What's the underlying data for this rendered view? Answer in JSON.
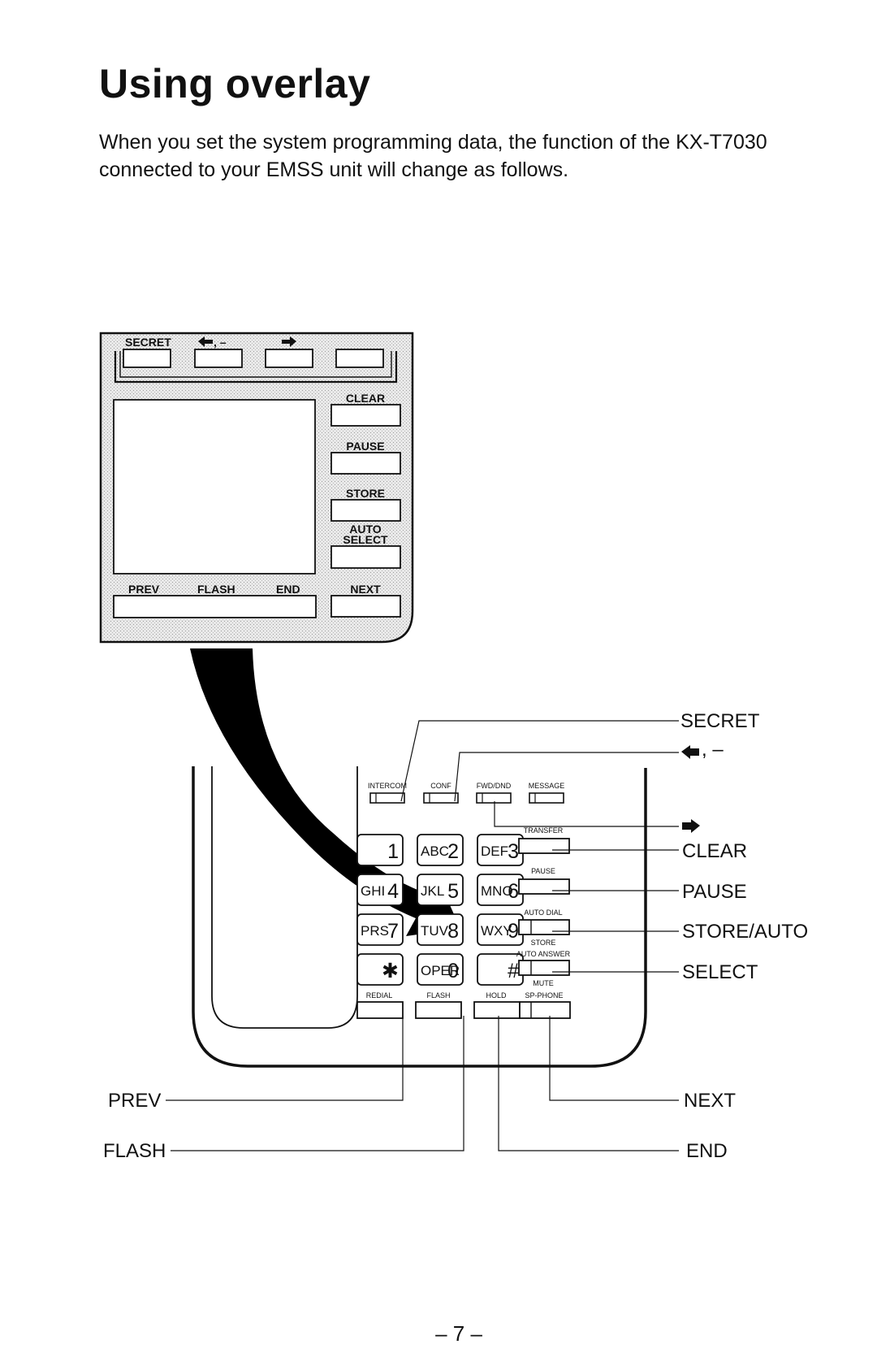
{
  "page": {
    "title": "Using overlay",
    "intro": "When you set the system programming data, the function of the KX-T7030 connected to your EMSS unit will change as follows.",
    "page_number": "– 7 –"
  },
  "overlay": {
    "top_keys": [
      {
        "label": "SECRET",
        "icon": null
      },
      {
        "label": ", –",
        "icon": "left-arrow-icon"
      },
      {
        "label": "",
        "icon": "right-arrow-icon"
      },
      {
        "label": "",
        "icon": null
      }
    ],
    "right_keys": [
      "CLEAR",
      "PAUSE",
      "STORE",
      "AUTO",
      "SELECT",
      "NEXT"
    ],
    "bottom_bar_labels": [
      "PREV",
      "FLASH",
      "END"
    ]
  },
  "phone": {
    "function_keys": [
      "INTERCOM",
      "CONF",
      "FWD/DND",
      "MESSAGE"
    ],
    "keypad": [
      {
        "letters": "",
        "digit": "1"
      },
      {
        "letters": "ABC",
        "digit": "2"
      },
      {
        "letters": "DEF",
        "digit": "3"
      },
      {
        "letters": "GHI",
        "digit": "4"
      },
      {
        "letters": "JKL",
        "digit": "5"
      },
      {
        "letters": "MNO",
        "digit": "6"
      },
      {
        "letters": "PRS",
        "digit": "7"
      },
      {
        "letters": "TUV",
        "digit": "8"
      },
      {
        "letters": "WXY",
        "digit": "9"
      },
      {
        "letters": "",
        "digit": "✱"
      },
      {
        "letters": "OPER",
        "digit": "0"
      },
      {
        "letters": "",
        "digit": "#"
      }
    ],
    "side_keys": {
      "transfer": "TRANSFER",
      "pause": "PAUSE",
      "auto_dial": "AUTO DIAL",
      "store": "STORE",
      "auto_answer": "AUTO ANSWER",
      "mute": "MUTE",
      "sp_phone": "SP-PHONE"
    },
    "bottom_keys": [
      "REDIAL",
      "FLASH",
      "HOLD",
      "SP-PHONE"
    ]
  },
  "callouts": {
    "right": [
      {
        "label": "SECRET",
        "icon": null
      },
      {
        "label": ", –",
        "icon": "left-arrow-icon"
      },
      {
        "label": "",
        "icon": "right-arrow-icon"
      },
      {
        "label": "CLEAR",
        "icon": null
      },
      {
        "label": "PAUSE",
        "icon": null
      },
      {
        "label": "STORE/AUTO",
        "icon": null
      },
      {
        "label": "SELECT",
        "icon": null
      },
      {
        "label": "NEXT",
        "icon": null
      },
      {
        "label": "END",
        "icon": null
      }
    ],
    "left": [
      {
        "label": "PREV"
      },
      {
        "label": "FLASH"
      }
    ]
  }
}
